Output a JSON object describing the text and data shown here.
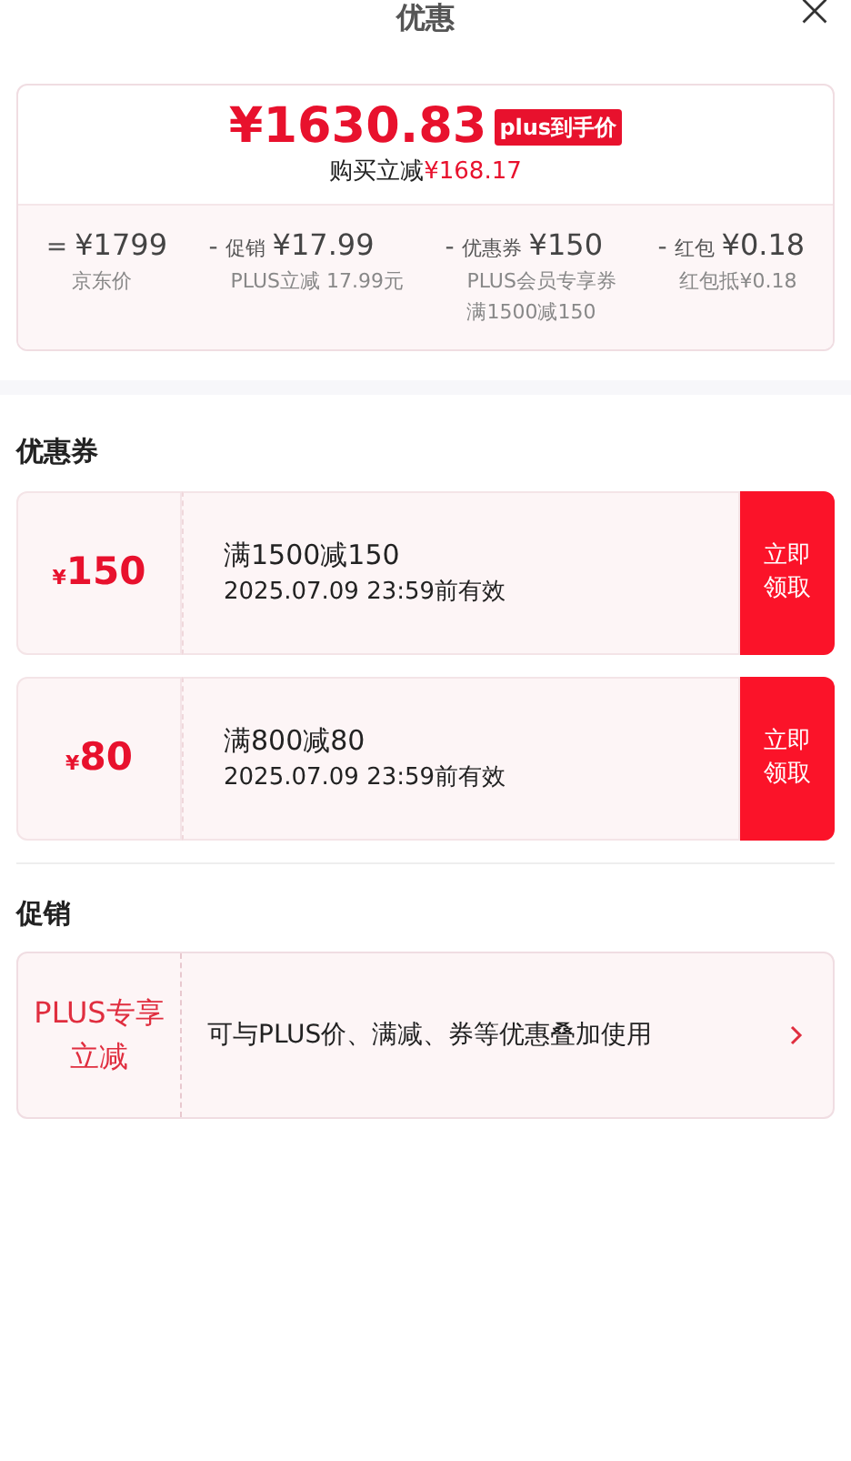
{
  "header": {
    "title": "优惠"
  },
  "summary": {
    "price": "¥1630.83",
    "badge": "plus到手价",
    "saving_label": "购买立减",
    "saving_amount": "¥168.17",
    "breakdown": [
      {
        "op": "=",
        "amount": "¥1799",
        "notes": [
          "京东价"
        ]
      },
      {
        "op": "-",
        "label": "促销",
        "amount": "¥17.99",
        "notes": [
          "PLUS立减 17.99元"
        ]
      },
      {
        "op": "-",
        "label": "优惠券",
        "amount": "¥150",
        "notes": [
          "PLUS会员专享券",
          "满1500减150"
        ]
      },
      {
        "op": "-",
        "label": "红包",
        "amount": "¥0.18",
        "notes": [
          "红包抵¥0.18"
        ]
      }
    ]
  },
  "coupons_section": {
    "title": "优惠券",
    "coupons": [
      {
        "currency": "¥",
        "value": "150",
        "condition": "满1500减150",
        "validity": "2025.07.09 23:59前有效",
        "button": "立即领取"
      },
      {
        "currency": "¥",
        "value": "80",
        "condition": "满800减80",
        "validity": "2025.07.09 23:59前有效",
        "button": "立即领取"
      }
    ]
  },
  "promo_section": {
    "title": "促销",
    "promos": [
      {
        "tag": "PLUS专享立减",
        "text": "可与PLUS价、满减、券等优惠叠加使用"
      }
    ]
  }
}
